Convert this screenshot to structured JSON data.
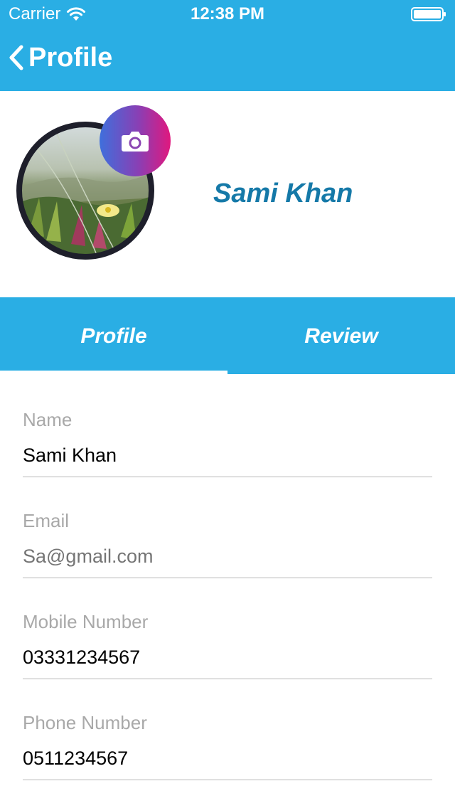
{
  "status_bar": {
    "carrier": "Carrier",
    "time": "12:38 PM"
  },
  "nav": {
    "back_label": "Profile"
  },
  "profile": {
    "name": "Sami Khan",
    "avatar_icon": "camera-icon"
  },
  "tabs": [
    {
      "label": "Profile",
      "active": true
    },
    {
      "label": "Review",
      "active": false
    }
  ],
  "form": {
    "fields": [
      {
        "label": "Name",
        "value": "Sami Khan",
        "is_placeholder": false
      },
      {
        "label": "Email",
        "value": "Sa@gmail.com",
        "is_placeholder": true
      },
      {
        "label": "Mobile Number",
        "value": "03331234567",
        "is_placeholder": false
      },
      {
        "label": "Phone Number",
        "value": "0511234567",
        "is_placeholder": false
      }
    ]
  },
  "colors": {
    "primary": "#2aaee4",
    "name_text": "#1579a8",
    "label_gray": "#a9a9a9"
  }
}
